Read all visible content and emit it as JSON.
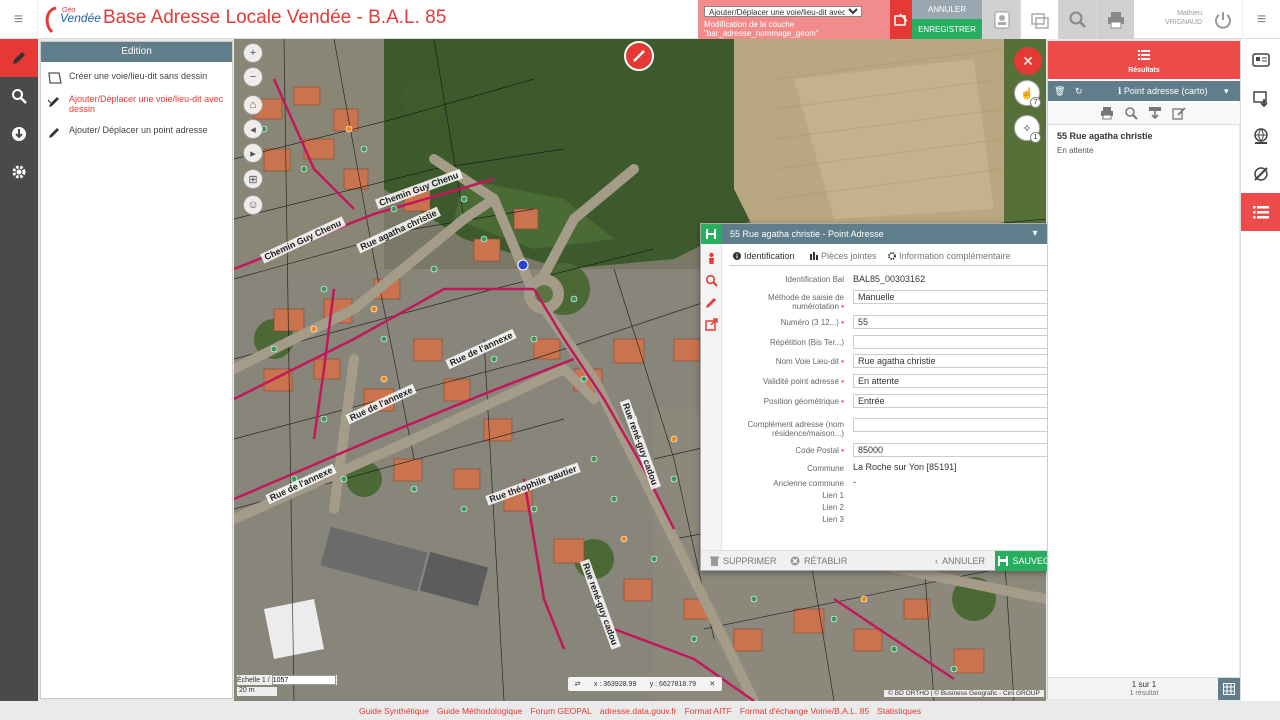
{
  "app": {
    "title": "Base Adresse Locale Vendée - B.A.L. 85",
    "logo_text": "Vendée",
    "logo_small": "Géo"
  },
  "header": {
    "mode_select": "Ajouter/Déplacer une voie/lieu-dit avec dessin",
    "notice": "Modification de la couche \"bar_adresse_nommage_geom\"",
    "annuler": "ANNULER",
    "enregistrer": "ENREGISTRER",
    "user_first": "Mathieu",
    "user_last": "VRIGNAUD"
  },
  "edit_panel": {
    "title": "Edition",
    "items": [
      {
        "label": "Créer une voie/lieu-dit sans dessin",
        "active": false
      },
      {
        "label": "Ajouter/Déplacer une voie/lieu-dit avec dessin",
        "active": true
      },
      {
        "label": "Ajouter/ Déplacer un point adresse",
        "active": false
      }
    ]
  },
  "map": {
    "road_labels": [
      "Chemin Guy Chenu",
      "Chemin Guy Chenu",
      "Rue agatha christie",
      "Rue de l'annexe",
      "Rue de l'annexe",
      "Rue de l'annexe",
      "Rue rené-guy cadou",
      "Rue théophile gautier",
      "Rue rené-guy cadou"
    ],
    "scale_label": "Échelle 1 /",
    "scale_value": "1057",
    "scale_bar": "20 m",
    "coord_x_label": "x :",
    "coord_x": "363928.99",
    "coord_y_label": "y :",
    "coord_y": "6627818.79",
    "copyright": "© BD ORTHO | © Business Geografic - Ciril GROUP",
    "selection_count_1": "7",
    "selection_count_2": "1"
  },
  "dialog": {
    "title": "55 Rue agatha christie - Point Adresse",
    "tabs": [
      "Identification",
      "Pièces jointes",
      "Information complémentaire"
    ],
    "fields": {
      "identification_label": "Identification Bal",
      "identification_value": "BAL85_00303162",
      "methode_label": "Méthode de saisie de numérotation",
      "methode_value": "Manuelle",
      "numero_label": "Numéro (3 12...)",
      "numero_value": "55",
      "repetition_label": "Répétition (Bis Ter...)",
      "repetition_value": "",
      "voie_label": "Nom Voie Lieu-dit",
      "voie_value": "Rue agatha christie",
      "validite_label": "Validité point adresse",
      "validite_value": "En attente",
      "position_label": "Position géométrique",
      "position_value": "Entrée",
      "complement_label": "Complément adresse (nom résidence/maison...)",
      "complement_value": "",
      "cp_label": "Code Postal",
      "cp_value": "85000",
      "commune_label": "Commune",
      "commune_value": "La Roche sur Yon [85191]",
      "ancienne_label": "Ancienne commune",
      "ancienne_value": "-",
      "lien1_label": "Lien 1",
      "lien2_label": "Lien 2",
      "lien3_label": "Lien 3"
    },
    "footer": {
      "supprimer": "SUPPRIMER",
      "retablir": "RÉTABLIR",
      "annuler": "ANNULER",
      "sauvegarder": "SAUVEGARDER"
    }
  },
  "results": {
    "title": "Résultats",
    "layer": "Point adresse (carto)",
    "item_title": "55 Rue agatha christie",
    "item_status": "En attente",
    "count": "1 sur 1",
    "count_sub": "1 résultat"
  },
  "footer_links": [
    "Guide Synthétique",
    "Guide Méthodologique",
    "Forum GEOPAL",
    "adresse.data.gouv.fr",
    "Format AITF",
    "Format d'échange Voirie/B.A.L. 85",
    "Statistiques"
  ],
  "colors": {
    "brand_red": "#e53935",
    "header_slate": "#607d8b",
    "save_green": "#27ae60",
    "rail_dark": "#4a4a4a"
  }
}
